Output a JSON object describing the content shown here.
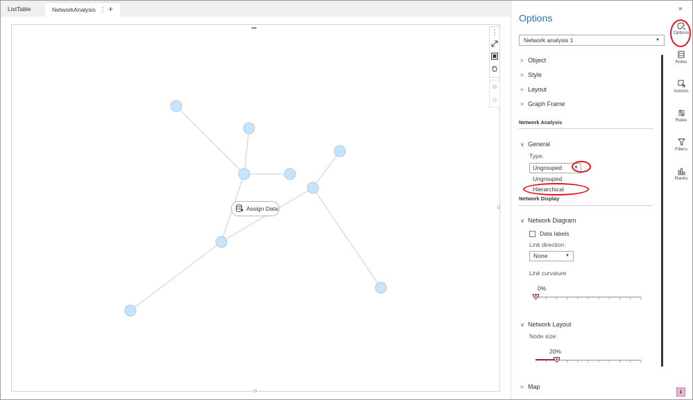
{
  "tabs": [
    {
      "label": "ListTable"
    },
    {
      "label": "NetworkAnalysis"
    }
  ],
  "tab_add": "+",
  "tab_menu": "⋮",
  "canvas": {
    "grip": "••••",
    "assign_data_label": "Assign Data"
  },
  "options": {
    "title": "Options",
    "object_select": "Network analysis 1",
    "accordions": [
      "Object",
      "Style",
      "Layout",
      "Graph Frame"
    ],
    "network_analysis_header": "Network Analysis",
    "general_label": "General",
    "type_label": "Type:",
    "type_value": "Ungrouped",
    "type_options": [
      "Ungrouped",
      "Hierarchical"
    ],
    "network_display_header": "Network Display",
    "network_diagram_label": "Network Diagram",
    "data_labels": "Data labels",
    "link_direction_label": "Link direction:",
    "link_direction_value": "None",
    "link_curvature_label": "Link curvature",
    "link_curvature_value": "0%",
    "link_curvature_pct": 0,
    "network_layout_label": "Network Layout",
    "node_size_label": "Node size:",
    "node_size_value": "20%",
    "node_size_pct": 20,
    "map_label": "Map"
  },
  "rail": {
    "collapse": "»",
    "items": [
      {
        "label": "Options",
        "icon": "paintbrush-icon"
      },
      {
        "label": "Roles",
        "icon": "roles-icon"
      },
      {
        "label": "Actions",
        "icon": "actions-icon"
      },
      {
        "label": "Rules",
        "icon": "rules-icon"
      },
      {
        "label": "Filters",
        "icon": "filter-icon"
      },
      {
        "label": "Ranks",
        "icon": "ranks-icon"
      }
    ]
  },
  "colors": {
    "accent": "#2f73b4",
    "node_fill": "#c9e3fa",
    "node_stroke": "#a9cdee",
    "edge": "#d4d4d4",
    "slider_fill": "#8b2252",
    "annotation": "#e8141a"
  }
}
